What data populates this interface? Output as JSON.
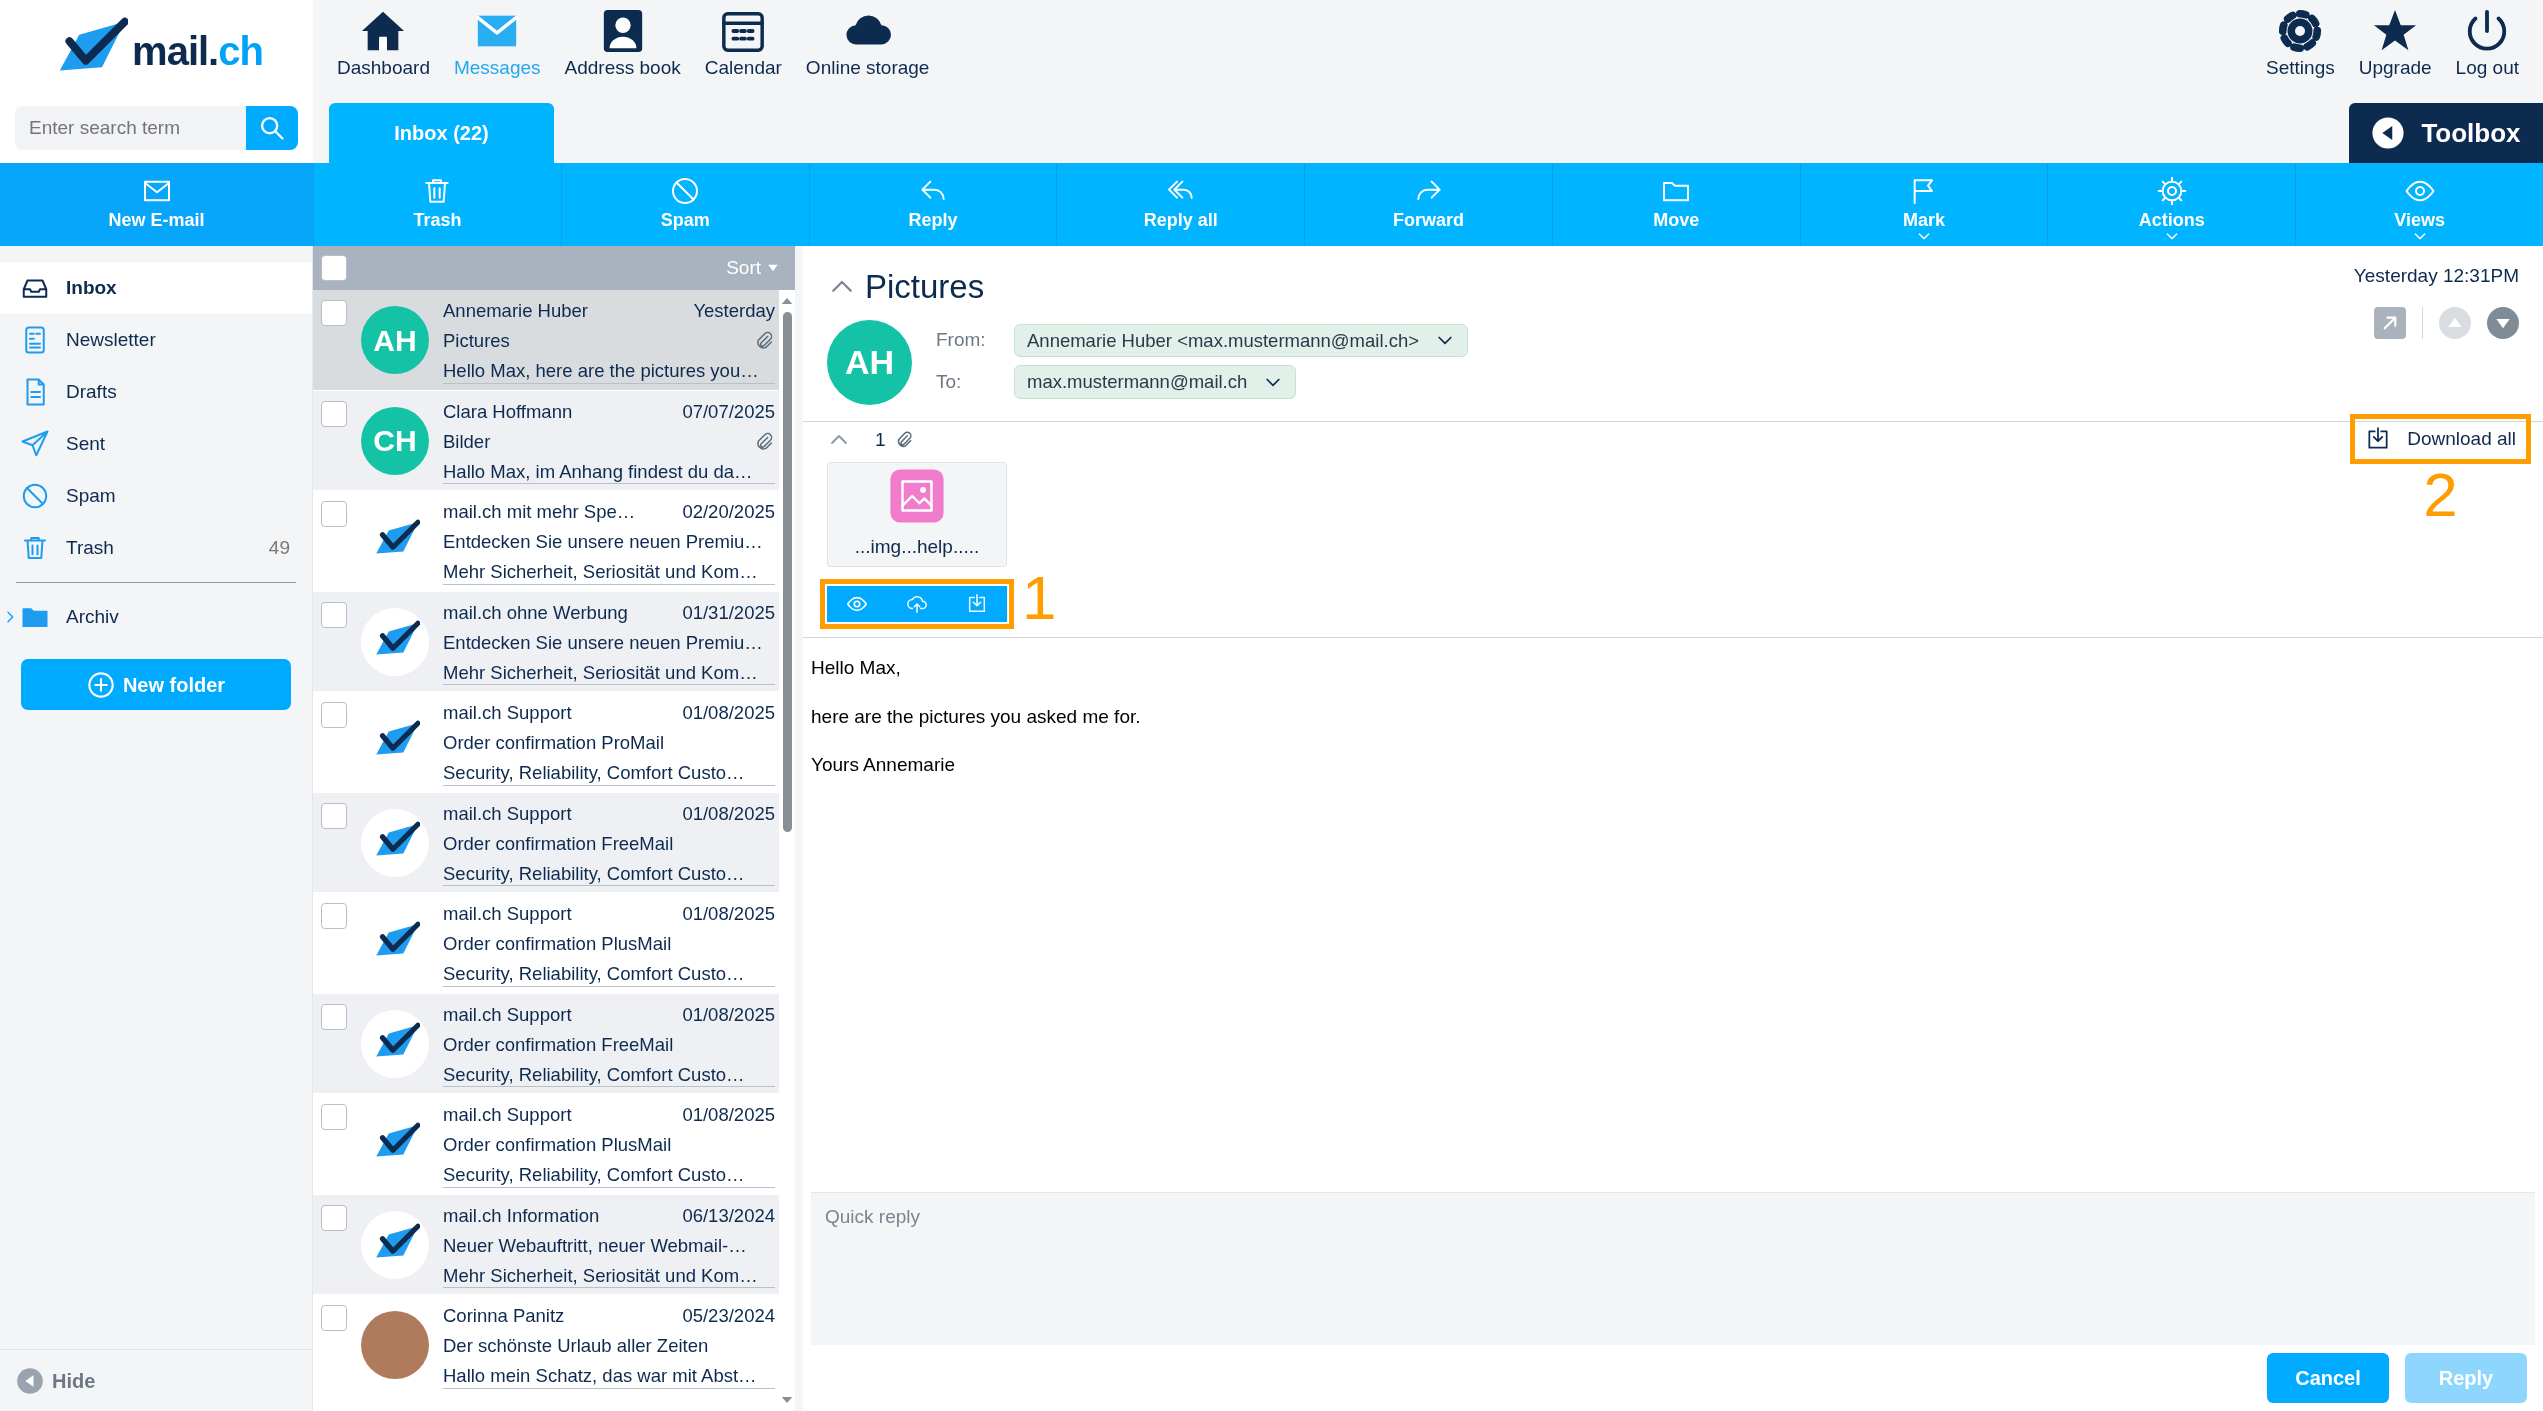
{
  "logo": {
    "name": "mail.",
    "suffix": "ch"
  },
  "search": {
    "placeholder": "Enter search term"
  },
  "top_nav": [
    {
      "label": "Dashboard",
      "selected": false
    },
    {
      "label": "Messages",
      "selected": true
    },
    {
      "label": "Address book",
      "selected": false
    },
    {
      "label": "Calendar",
      "selected": false
    },
    {
      "label": "Online storage",
      "selected": false
    }
  ],
  "top_actions": [
    {
      "label": "Settings"
    },
    {
      "label": "Upgrade"
    },
    {
      "label": "Log out"
    }
  ],
  "folder_tab": {
    "label": "Inbox (22)",
    "selected": true
  },
  "toolbox": {
    "label": "Toolbox"
  },
  "toolbar": [
    {
      "label": "New E-mail",
      "dropdown": false
    },
    {
      "label": "Trash",
      "dropdown": false
    },
    {
      "label": "Spam",
      "dropdown": false
    },
    {
      "label": "Reply",
      "dropdown": false
    },
    {
      "label": "Reply all",
      "dropdown": false
    },
    {
      "label": "Forward",
      "dropdown": false
    },
    {
      "label": "Move",
      "dropdown": false
    },
    {
      "label": "Mark",
      "dropdown": true
    },
    {
      "label": "Actions",
      "dropdown": true
    },
    {
      "label": "Views",
      "dropdown": true
    }
  ],
  "folders": [
    {
      "label": "Inbox",
      "selected": true
    },
    {
      "label": "Newsletter",
      "selected": false
    },
    {
      "label": "Drafts",
      "selected": false
    },
    {
      "label": "Sent",
      "selected": false
    },
    {
      "label": "Spam",
      "selected": false
    },
    {
      "label": "Trash",
      "selected": false,
      "count": "49"
    },
    {
      "label": "Archiv",
      "selected": false,
      "expanded": false
    }
  ],
  "new_folder": {
    "label": "New folder"
  },
  "hide": {
    "label": "Hide"
  },
  "message_list": {
    "sort": "Sort",
    "select_all_checked": false,
    "messages": [
      {
        "sender": "Annemarie Huber",
        "date": "Yesterday",
        "subject": "Pictures",
        "preview": "Hello Max, here are the pictures you…",
        "avatar": {
          "kind": "initials",
          "initials": "AH"
        },
        "attachment": true,
        "selected": true,
        "checked": false
      },
      {
        "sender": "Clara Hoffmann",
        "date": "07/07/2025",
        "subject": "Bilder",
        "preview": "Hallo Max, im Anhang findest du da…",
        "avatar": {
          "kind": "initials",
          "initials": "CH"
        },
        "attachment": true,
        "selected": false,
        "checked": false
      },
      {
        "sender": "mail.ch mit mehr Spe…",
        "date": "02/20/2025",
        "subject": "Entdecken Sie unsere neuen Premiu…",
        "preview": "Mehr Sicherheit, Seriosität und Kom…",
        "avatar": {
          "kind": "logo"
        },
        "attachment": false,
        "selected": false,
        "checked": false
      },
      {
        "sender": "mail.ch ohne Werbung",
        "date": "01/31/2025",
        "subject": "Entdecken Sie unsere neuen Premiu…",
        "preview": "Mehr Sicherheit, Seriosität und Kom…",
        "avatar": {
          "kind": "logo"
        },
        "attachment": false,
        "selected": false,
        "checked": false
      },
      {
        "sender": "mail.ch Support",
        "date": "01/08/2025",
        "subject": "Order confirmation ProMail",
        "preview": "Security, Reliability, Comfort Custo…",
        "avatar": {
          "kind": "logo"
        },
        "attachment": false,
        "selected": false,
        "checked": false
      },
      {
        "sender": "mail.ch Support",
        "date": "01/08/2025",
        "subject": "Order confirmation FreeMail",
        "preview": "Security, Reliability, Comfort Custo…",
        "avatar": {
          "kind": "logo"
        },
        "attachment": false,
        "selected": false,
        "checked": false
      },
      {
        "sender": "mail.ch Support",
        "date": "01/08/2025",
        "subject": "Order confirmation PlusMail",
        "preview": "Security, Reliability, Comfort Custo…",
        "avatar": {
          "kind": "logo"
        },
        "attachment": false,
        "selected": false,
        "checked": false
      },
      {
        "sender": "mail.ch Support",
        "date": "01/08/2025",
        "subject": "Order confirmation FreeMail",
        "preview": "Security, Reliability, Comfort Custo…",
        "avatar": {
          "kind": "logo"
        },
        "attachment": false,
        "selected": false,
        "checked": false
      },
      {
        "sender": "mail.ch Support",
        "date": "01/08/2025",
        "subject": "Order confirmation PlusMail",
        "preview": "Security, Reliability, Comfort Custo…",
        "avatar": {
          "kind": "logo"
        },
        "attachment": false,
        "selected": false,
        "checked": false
      },
      {
        "sender": "mail.ch Information",
        "date": "06/13/2024",
        "subject": "Neuer Webauftritt, neuer Webmail-…",
        "preview": "Mehr Sicherheit, Seriosität und Kom…",
        "avatar": {
          "kind": "logo"
        },
        "attachment": false,
        "selected": false,
        "checked": false
      },
      {
        "sender": "Corinna Panitz",
        "date": "05/23/2024",
        "subject": "Der schönste Urlaub aller Zeiten",
        "preview": "Hallo mein Schatz, das war mit Abst…",
        "avatar": {
          "kind": "photo"
        },
        "attachment": false,
        "selected": false,
        "checked": false
      }
    ]
  },
  "reading": {
    "subject": "Pictures",
    "date": "Yesterday 12:31PM",
    "avatar_initials": "AH",
    "from_label": "From:",
    "from": "Annemarie Huber <max.mustermann@mail.ch>",
    "to_label": "To:",
    "to": "max.mustermann@mail.ch",
    "attachment_count": "1",
    "attachments": [
      {
        "name": "...img...help....."
      }
    ],
    "download_all": "Download all",
    "body": [
      "Hello Max,",
      "here are the pictures you asked me for.",
      "Yours Annemarie"
    ]
  },
  "annotations": [
    {
      "label": "1"
    },
    {
      "label": "2"
    }
  ],
  "quick_reply": {
    "placeholder": "Quick reply",
    "buttons": [
      {
        "label": "Cancel",
        "disabled": false
      },
      {
        "label": "Reply",
        "disabled": true
      }
    ]
  }
}
